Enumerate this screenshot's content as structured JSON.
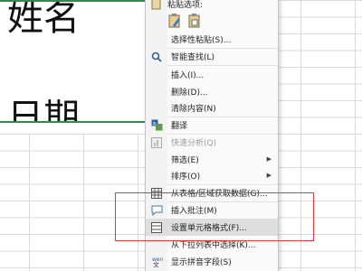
{
  "cells": {
    "line1": "姓名",
    "line2": "日期"
  },
  "menu": {
    "paste_header": "粘贴选项:",
    "items": [
      {
        "label": "选择性粘贴(S)...",
        "icon": ""
      },
      {
        "label": "智能查找(L)",
        "icon": "search-icon"
      },
      {
        "label": "插入(I)...",
        "icon": ""
      },
      {
        "label": "删除(D)...",
        "icon": ""
      },
      {
        "label": "清除内容(N)",
        "icon": ""
      },
      {
        "label": "翻译",
        "icon": "translate-icon"
      },
      {
        "label": "快速分析(Q)",
        "icon": "quick-analysis-icon"
      },
      {
        "label": "筛选(E)",
        "icon": ""
      },
      {
        "label": "排序(O)",
        "icon": ""
      },
      {
        "label": "从表格/区域获取数据(G)...",
        "icon": "table-icon"
      },
      {
        "label": "插入批注(M)",
        "icon": "comment-icon"
      },
      {
        "label": "设置单元格格式(F)...",
        "icon": "format-cells-icon"
      },
      {
        "label": "从下拉列表中选择(K)...",
        "icon": ""
      },
      {
        "label": "显示拼音字段(S)",
        "icon": "phonetic-icon"
      }
    ]
  },
  "colors": {
    "highlight": "#dedede",
    "annotation": "#e0393e",
    "selection": "#2f8a4e"
  }
}
